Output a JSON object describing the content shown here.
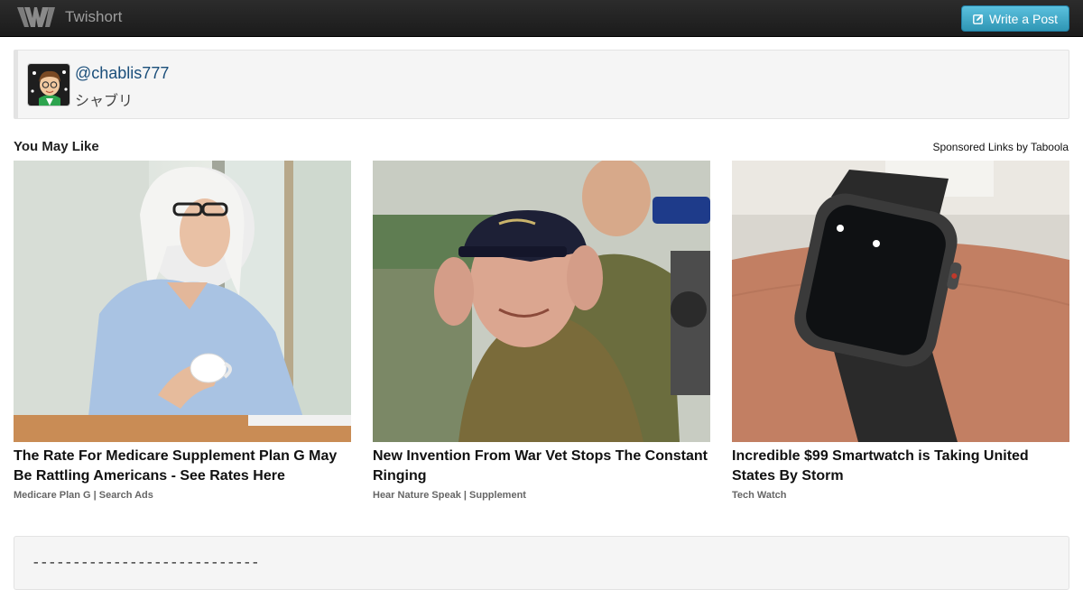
{
  "navbar": {
    "brand_name": "Twishort",
    "write_label": "Write a Post"
  },
  "profile": {
    "handle": "@chablis777",
    "display_name": "シャブリ"
  },
  "recommendations": {
    "title": "You May Like",
    "sponsored_label": "Sponsored Links by Taboola",
    "cards": [
      {
        "title": "The Rate For Medicare Supplement Plan G May Be Rattling Americans - See Rates Here",
        "source": "Medicare Plan G | Search Ads"
      },
      {
        "title": "New Invention From War Vet Stops The Constant Ringing",
        "source": "Hear Nature Speak | Supplement"
      },
      {
        "title": "Incredible $99 Smartwatch is Taking United States By Storm",
        "source": "Tech Watch"
      }
    ]
  },
  "post": {
    "dashes": "----------------------------"
  },
  "colors": {
    "navbar_bg": "#222222",
    "button_info": "#49afcd",
    "link": "#1a4e7a"
  },
  "icons": {
    "brand": "twishort-logo-icon",
    "write": "edit-icon"
  }
}
